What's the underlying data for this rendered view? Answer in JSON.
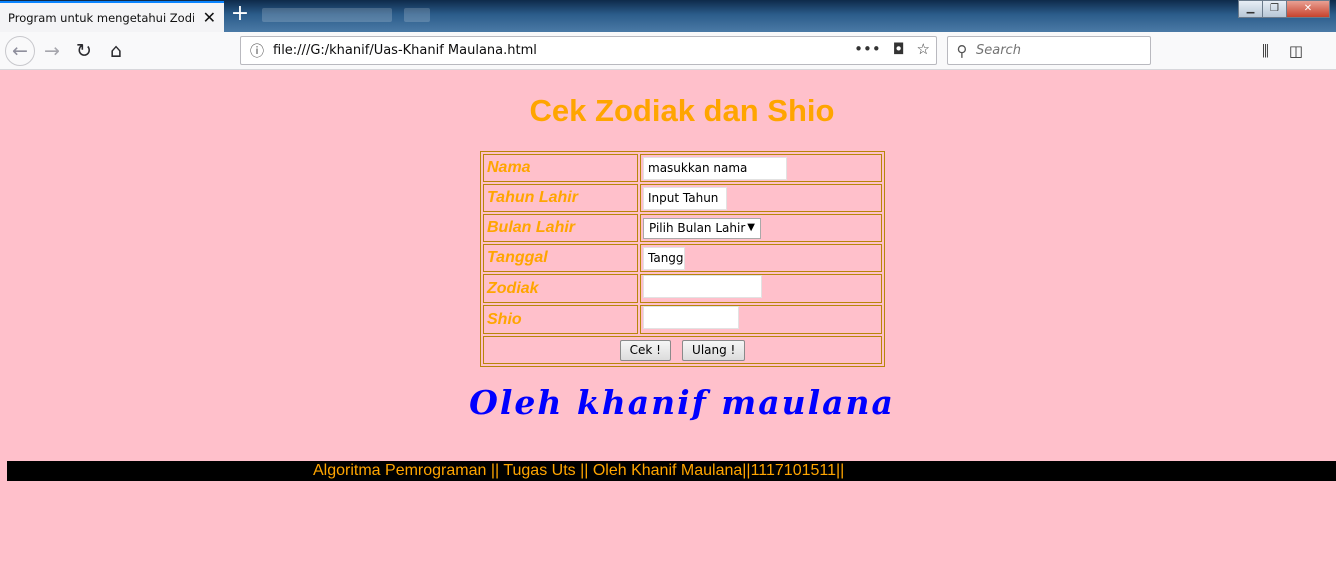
{
  "browser": {
    "tab_title": "Program untuk mengetahui Zodiak",
    "url": "file:///G:/khanif/Uas-Khanif Maulana.html",
    "search_placeholder": "Search"
  },
  "page": {
    "title": "Cek Zodiak dan Shio",
    "form": {
      "rows": [
        {
          "label": "Nama",
          "value": "masukkan nama"
        },
        {
          "label": "Tahun Lahir",
          "value": "Input Tahun"
        },
        {
          "label": "Bulan Lahir",
          "value": "Pilih Bulan Lahir"
        },
        {
          "label": "Tanggal",
          "value": "Tangg"
        },
        {
          "label": "Zodiak",
          "value": ""
        },
        {
          "label": "Shio",
          "value": ""
        }
      ],
      "submit_label": "Cek !",
      "reset_label": "Ulang !"
    },
    "author_text": "Oleh khanif maulana",
    "footer_text": "Algoritma Pemrograman || Tugas Uts || Oleh Khanif Maulana||1117101511||"
  },
  "colors": {
    "background": "#ffc0cb",
    "heading": "#ffa500",
    "author": "#0000ff",
    "footer_bg": "#000000"
  }
}
